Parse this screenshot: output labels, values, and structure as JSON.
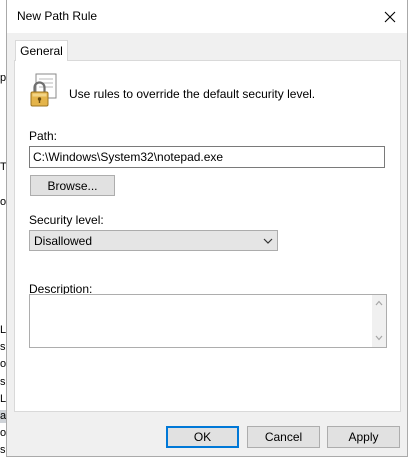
{
  "background": {
    "left_edge_chars": [
      "p",
      "T",
      "o",
      "L",
      "s",
      "o",
      "s",
      "L",
      "a",
      "o",
      "s"
    ]
  },
  "dialog": {
    "title": "New Path Rule",
    "close_icon": "close-icon"
  },
  "tabs": [
    {
      "label": "General",
      "selected": true
    }
  ],
  "general": {
    "icon": "lock-document-icon",
    "intro_text": "Use rules to override the default security level.",
    "path_label": "Path:",
    "path_value": "C:\\Windows\\System32\\notepad.exe",
    "browse_label": "Browse...",
    "security_label": "Security level:",
    "security_value": "Disallowed",
    "description_label": "Description:",
    "description_value": ""
  },
  "buttons": {
    "ok": "OK",
    "cancel": "Cancel",
    "apply": "Apply"
  },
  "colors": {
    "dialog_bg": "#f0f0f0",
    "panel_bg": "#ffffff",
    "focus_border": "#0078d7"
  }
}
